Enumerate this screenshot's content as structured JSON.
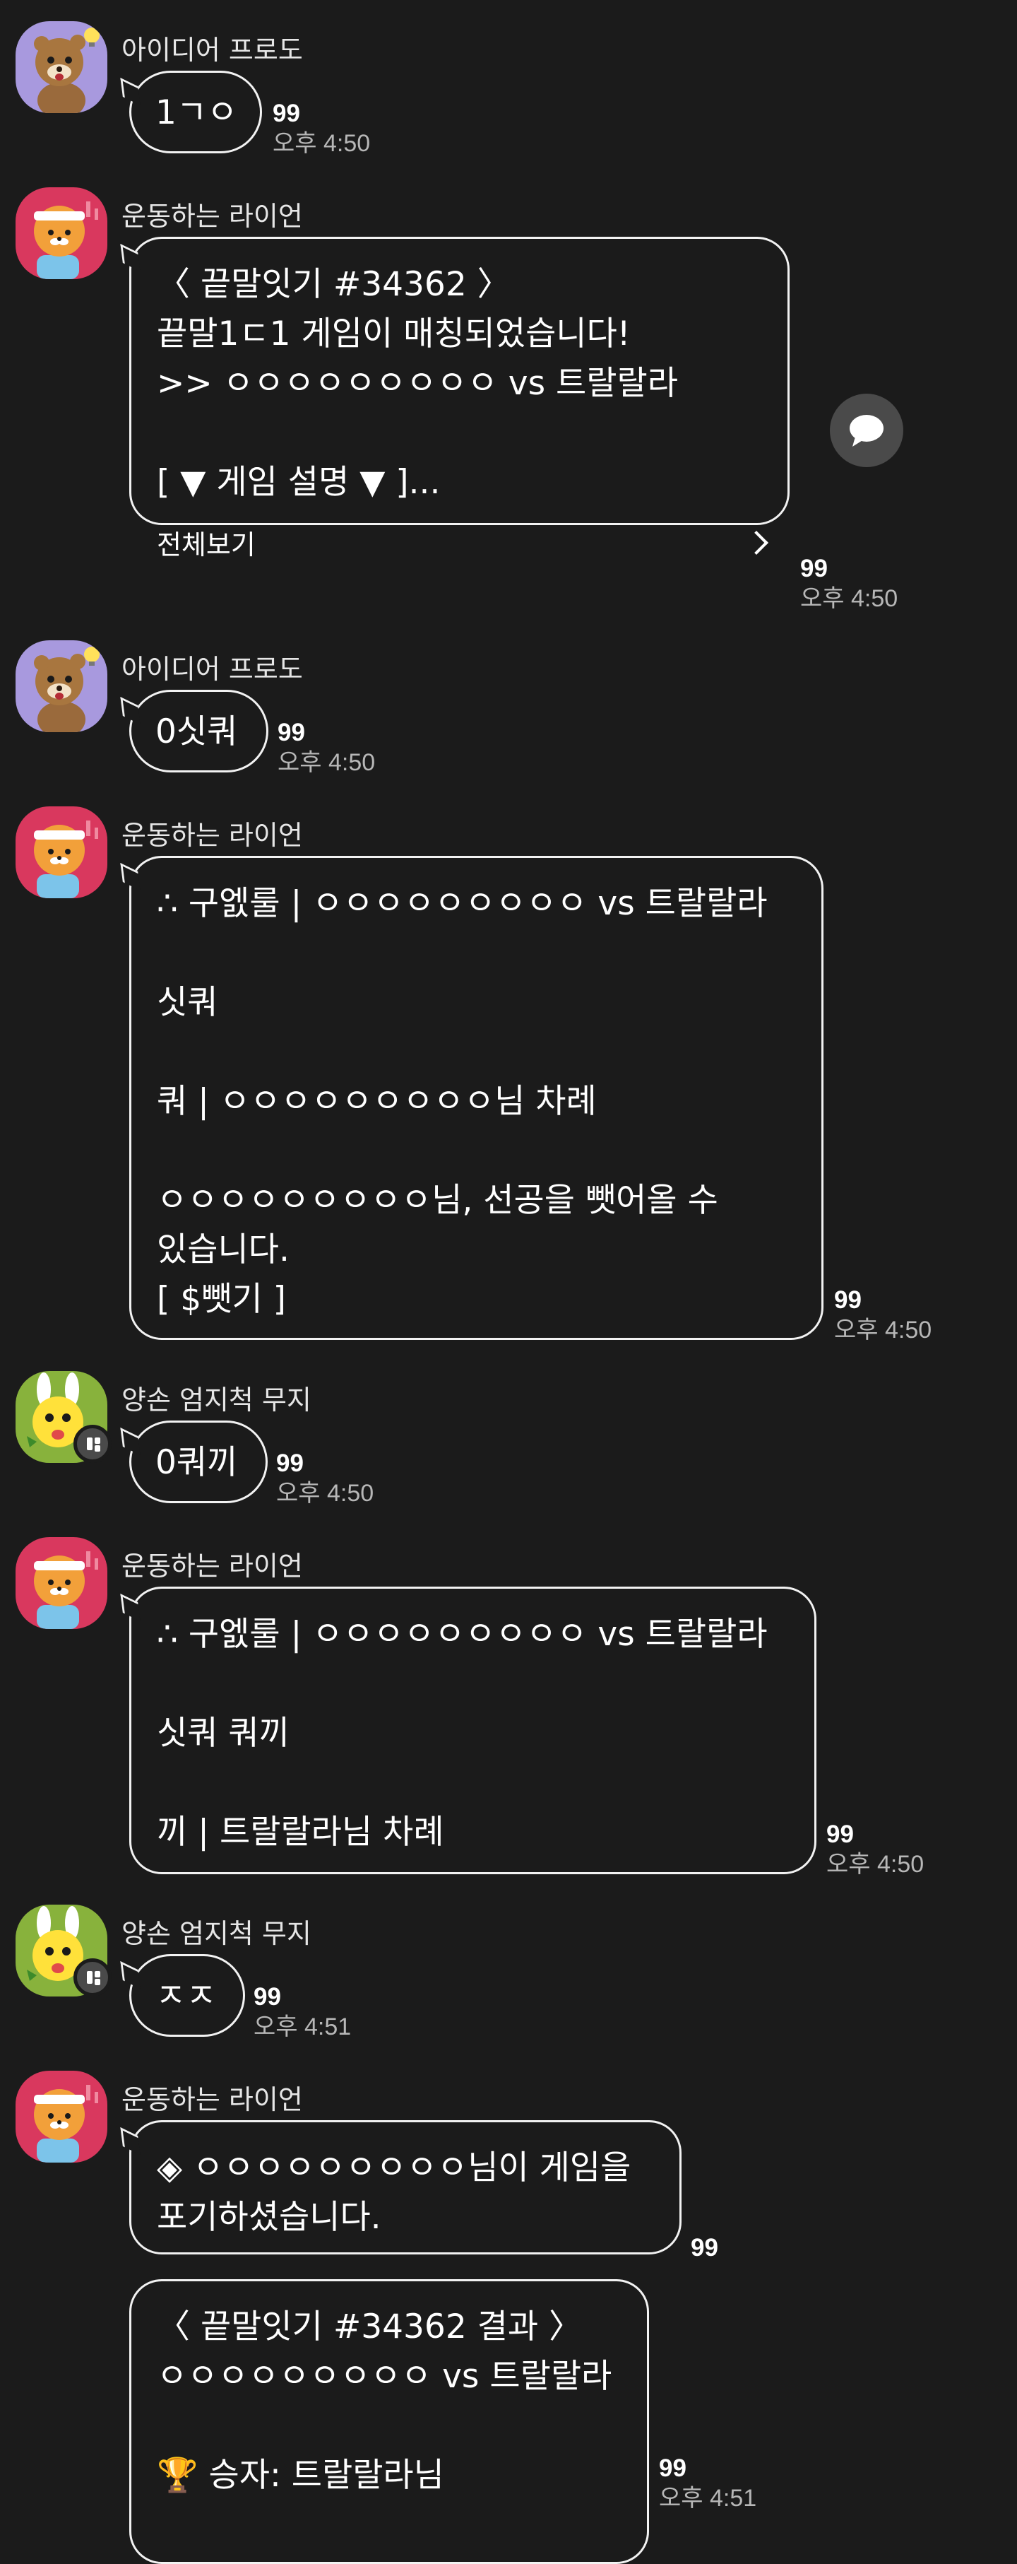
{
  "colors": {
    "background": "#1b1b1b",
    "bubble_border": "#f2f2f2",
    "time_text": "#b7b7b7",
    "avatar_frodo": "#a899de",
    "avatar_ryan": "#d9385e",
    "avatar_muzi": "#88b23c"
  },
  "messages": [
    {
      "sender": "아이디어 프로도",
      "avatar": "frodo-avatar",
      "text": "1ㄱㅇ",
      "count": "99",
      "time": "오후 4:50"
    },
    {
      "sender": "운동하는 라이언",
      "avatar": "ryan-avatar",
      "text": "〈 끝말잇기 #34362 〉\n끝말1ㄷ1 게임이 매칭되었습니다!\n>> ㅇㅇㅇㅇㅇㅇㅇㅇㅇ vs 트랄랄라\n\n[ ▼ 게임 설명 ▼ ]...",
      "more_label": "전체보기",
      "count": "99",
      "time": "오후 4:50",
      "share_icon": "speech-bubble-icon"
    },
    {
      "sender": "아이디어 프로도",
      "avatar": "frodo-avatar",
      "text": "0싯쿼",
      "count": "99",
      "time": "오후 4:50"
    },
    {
      "sender": "운동하는 라이언",
      "avatar": "ryan-avatar",
      "text": "∴ 구엜룰 | ㅇㅇㅇㅇㅇㅇㅇㅇㅇ vs 트랄랄라\n\n싯쿼\n\n쿼 | ㅇㅇㅇㅇㅇㅇㅇㅇㅇ님 차례\n\nㅇㅇㅇㅇㅇㅇㅇㅇㅇ님, 선공을 뺏어올 수\n있습니다.\n[ $뺏기 ]",
      "count": "99",
      "time": "오후 4:50"
    },
    {
      "sender": "양손 엄지척 무지",
      "avatar": "muzi-avatar",
      "text": "0쿼끼",
      "count": "99",
      "time": "오후 4:50"
    },
    {
      "sender": "운동하는 라이언",
      "avatar": "ryan-avatar",
      "text": "∴ 구엜룰 | ㅇㅇㅇㅇㅇㅇㅇㅇㅇ vs 트랄랄라\n\n싯쿼 쿼끼\n\n끼 | 트랄랄라님 차례",
      "count": "99",
      "time": "오후 4:50"
    },
    {
      "sender": "양손 엄지척 무지",
      "avatar": "muzi-avatar",
      "text": "ㅈㅈ",
      "count": "99",
      "time": "오후 4:51"
    },
    {
      "sender": "운동하는 라이언",
      "avatar": "ryan-avatar",
      "text": "◈ ㅇㅇㅇㅇㅇㅇㅇㅇㅇ님이 게임을\n포기하셨습니다.",
      "count": "99",
      "time": ""
    },
    {
      "sender": "",
      "avatar": "",
      "text": "〈 끝말잇기 #34362 결과 〉\nㅇㅇㅇㅇㅇㅇㅇㅇㅇ vs 트랄랄라\n\n🏆 승자: 트랄랄라님",
      "count": "99",
      "time": "오후 4:51"
    }
  ]
}
